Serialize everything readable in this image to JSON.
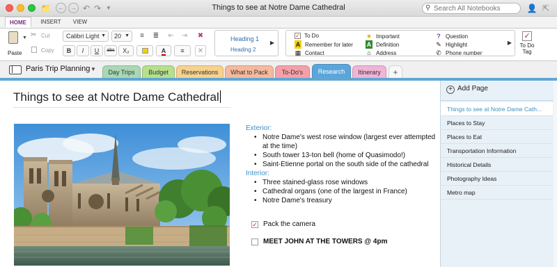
{
  "window": {
    "title": "Things to see at Notre Dame Cathedral"
  },
  "search": {
    "placeholder": "Search All Notebooks"
  },
  "ribbon_tabs": [
    {
      "label": "HOME",
      "active": true
    },
    {
      "label": "INSERT",
      "active": false
    },
    {
      "label": "VIEW",
      "active": false
    }
  ],
  "ribbon": {
    "paste_label": "Paste",
    "cut_label": "Cut",
    "copy_label": "Copy",
    "font_name": "Calibri Light",
    "font_size": "20",
    "bold": "B",
    "italic": "I",
    "underline": "U",
    "strike": "abc",
    "subscript": "X₂",
    "font_color_glyph": "A",
    "heading1": "Heading 1",
    "heading2": "Heading 2",
    "tags": [
      {
        "label": "To Do",
        "icon": "checkbox-icon",
        "color": "#c0392b"
      },
      {
        "label": "Remember for later",
        "icon": "highlight-a-icon",
        "color": "#f5d000"
      },
      {
        "label": "Contact",
        "icon": "contact-icon",
        "color": "#555555"
      },
      {
        "label": "Important",
        "icon": "star-icon",
        "color": "#e8a800"
      },
      {
        "label": "Definition",
        "icon": "definition-a-icon",
        "color": "#2e8b2e"
      },
      {
        "label": "Address",
        "icon": "home-icon",
        "color": "#555555"
      },
      {
        "label": "Question",
        "icon": "question-icon",
        "color": "#7a3fb5"
      },
      {
        "label": "Highlight",
        "icon": "pen-icon",
        "color": "#444444"
      },
      {
        "label": "Phone number",
        "icon": "phone-icon",
        "color": "#444444"
      }
    ],
    "todo_tag_label": "To Do Tag"
  },
  "notebook": {
    "name": "Paris Trip Planning",
    "sections": [
      {
        "label": "Day Trips",
        "color": "#a8d8b4",
        "active": false
      },
      {
        "label": "Budget",
        "color": "#b6e08c",
        "active": false
      },
      {
        "label": "Reservations",
        "color": "#f8d28c",
        "active": false
      },
      {
        "label": "What to Pack",
        "color": "#f6b99e",
        "active": false
      },
      {
        "label": "To-Do's",
        "color": "#f4a0a8",
        "active": false
      },
      {
        "label": "Research",
        "color": "#5aa6db",
        "active": true
      },
      {
        "label": "Itinerary",
        "color": "#f1b3d6",
        "active": false
      },
      {
        "label": "+",
        "color": "#f8f8f8",
        "active": false
      }
    ]
  },
  "page": {
    "title": "Things to see at Notre Dame Cathedral",
    "exterior_label": "Exterior:",
    "exterior_items": [
      "Notre Dame's west rose window (largest ever attempted at the time)",
      "South tower 13-ton bell (home of Quasimodo!)",
      "Saint-Etienne portal on the south side of the cathedral"
    ],
    "interior_label": "Interior:",
    "interior_items": [
      "Three stained-glass rose windows",
      "Cathedral organs (one of the largest in France)",
      "Notre Dame's treasury"
    ],
    "todos": [
      {
        "label": "Pack the camera",
        "checked": true,
        "bold": false
      },
      {
        "label": "MEET JOHN AT THE TOWERS @ 4pm",
        "checked": false,
        "bold": true
      }
    ]
  },
  "pages_pane": {
    "add_page_label": "Add Page",
    "pages": [
      {
        "label": "Things to see at Notre Dame Cath...",
        "active": true
      },
      {
        "label": "Places to Stay",
        "active": false
      },
      {
        "label": "Places to Eat",
        "active": false
      },
      {
        "label": "Transportation Information",
        "active": false
      },
      {
        "label": "Historical Details",
        "active": false
      },
      {
        "label": "Photography Ideas",
        "active": false
      },
      {
        "label": "Metro map",
        "active": false
      }
    ]
  }
}
